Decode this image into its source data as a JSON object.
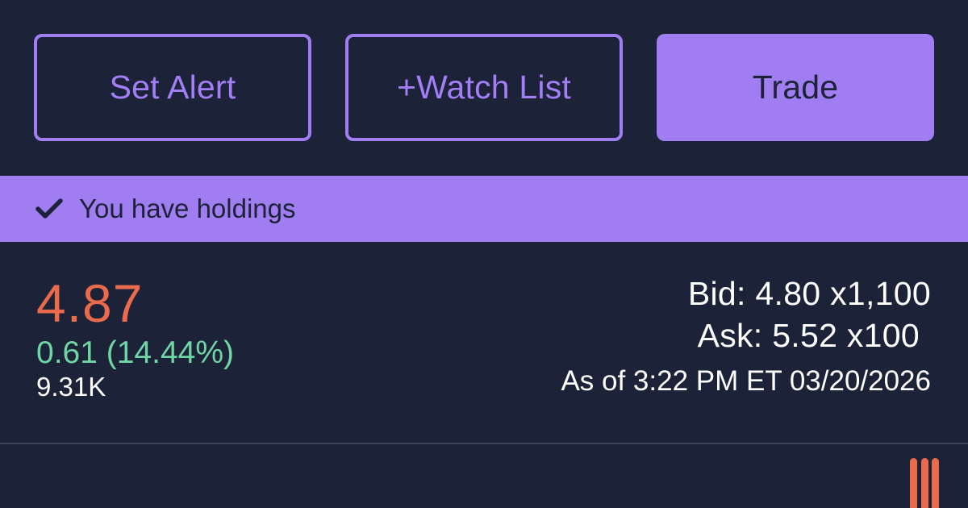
{
  "actions": {
    "set_alert_label": "Set Alert",
    "watch_list_label": "+Watch List",
    "trade_label": "Trade"
  },
  "holdings_banner": {
    "icon": "checkmark-icon",
    "text": "You have holdings"
  },
  "quote": {
    "last_price": "4.87",
    "change": "0.61 (14.44%)",
    "volume": "9.31K",
    "bid": "Bid: 4.80 x1,100",
    "ask": "Ask: 5.52 x100",
    "as_of": "As of 3:22 PM ET 03/20/2026"
  },
  "colors": {
    "background": "#1c2238",
    "accent": "#a07ef2",
    "price": "#ea6a4c",
    "change_positive": "#6fd6a3",
    "text": "#ffffff"
  },
  "menu_handle": {
    "icon": "menu-handle-icon"
  }
}
